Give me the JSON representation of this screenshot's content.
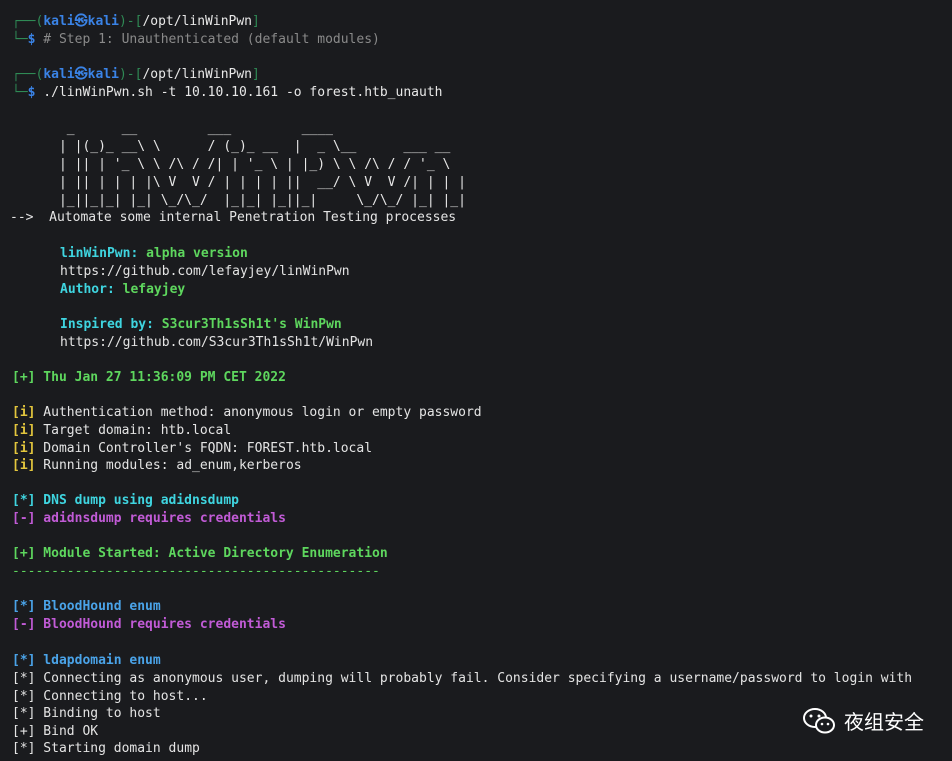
{
  "prompt1": {
    "box_top": "┌──(",
    "user": "kali",
    "at": "㉿",
    "host": "kali",
    "sep": ")-[",
    "path": "/opt/linWinPwn",
    "end": "]",
    "box_bottom": "└─",
    "dollar": "$",
    "command": " # Step 1: Unauthenticated (default modules)"
  },
  "prompt2": {
    "box_top": "┌──(",
    "user": "kali",
    "at": "㉿",
    "host": "kali",
    "sep": ")-[",
    "path": "/opt/linWinPwn",
    "end": "]",
    "box_bottom": "└─",
    "dollar": "$",
    "command": " ./linWinPwn.sh -t 10.10.10.161 -o forest.htb_unauth"
  },
  "banner": {
    "ascii": [
      "       _      __         ___         ____",
      "      | |(_)_ __\\ \\      / (_)_ __  |  _ \\__      ___ __",
      "      | || | '_ \\ \\ /\\ / /| | '_ \\ | |_) \\ \\ /\\ / / '_ \\",
      "      | || | | | |\\ V  V / | | | | ||  __/ \\ V  V /| | | |",
      "      |_||_|_| |_| \\_/\\_/  |_|_| |_||_|     \\_/\\_/ |_| |_|"
    ],
    "arrow": "-->",
    "tagline": "  Automate some internal Penetration Testing processes",
    "version_label": "linWinPwn: ",
    "version_value": "alpha version",
    "repo_url": "https://github.com/lefayjey/linWinPwn",
    "author_label": "Author: ",
    "author_value": "lefayjey",
    "inspired_label": "Inspired by: ",
    "inspired_value": "S3cur3Th1sSh1t's WinPwn",
    "inspired_url": "https://github.com/S3cur3Th1sSh1t/WinPwn"
  },
  "output": {
    "date_line": "[+] Thu Jan 27 11:36:09 PM CET 2022",
    "info": [
      {
        "tag": "[i]",
        "text": " Authentication method: anonymous login or empty password"
      },
      {
        "tag": "[i]",
        "text": " Target domain: htb.local"
      },
      {
        "tag": "[i]",
        "text": " Domain Controller's FQDN: FOREST.htb.local"
      },
      {
        "tag": "[i]",
        "text": " Running modules: ad_enum,kerberos"
      }
    ],
    "dns_star": "[*] DNS dump using adidnsdump",
    "dns_fail": "[-] adidnsdump requires credentials",
    "module_started": "[+] Module Started: Active Directory Enumeration",
    "separator": "-----------------------------------------------",
    "bh_star": "[*] BloodHound enum",
    "bh_fail": "[-] BloodHound requires credentials",
    "ldap_star": "[*] ldapdomain enum",
    "ldap_lines": [
      {
        "tag": "[*]",
        "text": " Connecting as anonymous user, dumping will probably fail. Consider specifying a username/password to login with"
      },
      {
        "tag": "[*]",
        "text": " Connecting to host..."
      },
      {
        "tag": "[*]",
        "text": " Binding to host"
      },
      {
        "tag": "[+]",
        "text": " Bind OK"
      },
      {
        "tag": "[*]",
        "text": " Starting domain dump"
      }
    ]
  },
  "watermark": {
    "text": "夜组安全",
    "icon": "wechat-icon"
  },
  "colors": {
    "background": "#1a1b1e",
    "prompt_box": "#2f8a55",
    "prompt_user": "#3a83e6",
    "cyan": "#3fd5e0",
    "green": "#5ed75e",
    "yellow": "#e3c63d",
    "magenta": "#c15bd6"
  }
}
